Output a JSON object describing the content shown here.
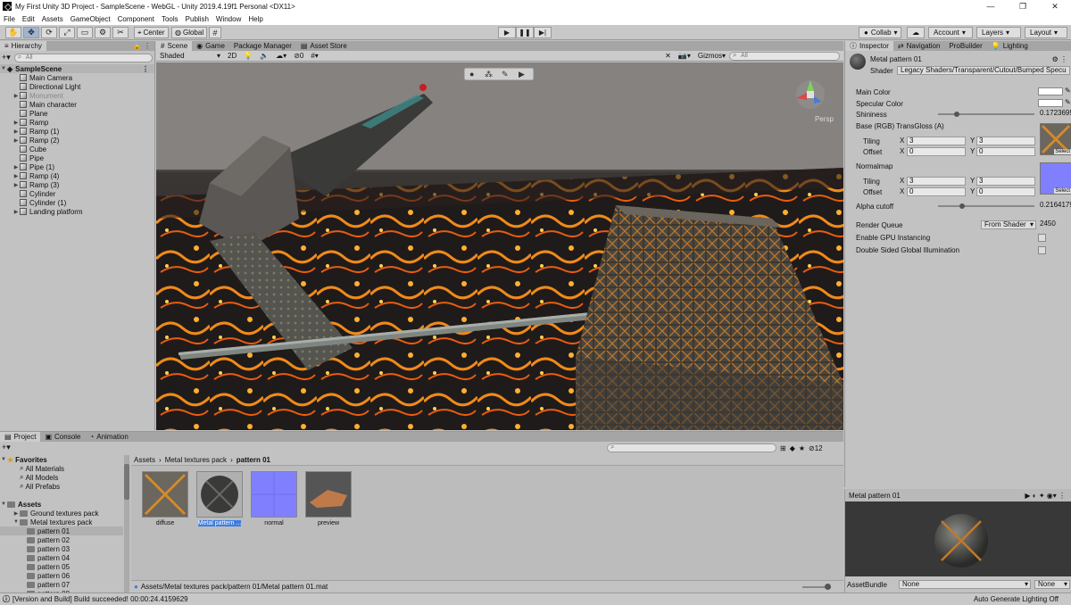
{
  "window": {
    "title": "My First Unity 3D Project - SampleScene - WebGL - Unity 2019.4.19f1 Personal <DX11>",
    "controls": [
      "—",
      "❐",
      "✕"
    ]
  },
  "menu": [
    "File",
    "Edit",
    "Assets",
    "GameObject",
    "Component",
    "Tools",
    "Publish",
    "Window",
    "Help"
  ],
  "toolbar": {
    "tools": [
      "✋",
      "✥",
      "⟳",
      "⤢",
      "▭",
      "⚙",
      "✂"
    ],
    "pivot": "Center",
    "space": "Global",
    "play": "▶",
    "pause": "❚❚",
    "step": "▶|",
    "collab": "Collab",
    "cloud": "☁",
    "account": "Account",
    "layers": "Layers",
    "layout": "Layout"
  },
  "hierarchy": {
    "tab": "Hierarchy",
    "search_placeholder": "All",
    "scene": "SampleScene",
    "items": [
      {
        "label": "Main Camera",
        "expandable": false,
        "disabled": false
      },
      {
        "label": "Directional Light",
        "expandable": false,
        "disabled": false
      },
      {
        "label": "Monument",
        "expandable": true,
        "disabled": true
      },
      {
        "label": "Main character",
        "expandable": false,
        "disabled": false
      },
      {
        "label": "Plane",
        "expandable": false,
        "disabled": false
      },
      {
        "label": "Ramp",
        "expandable": true,
        "disabled": false
      },
      {
        "label": "Ramp (1)",
        "expandable": true,
        "disabled": false
      },
      {
        "label": "Ramp (2)",
        "expandable": true,
        "disabled": false
      },
      {
        "label": "Cube",
        "expandable": false,
        "disabled": false
      },
      {
        "label": "Pipe",
        "expandable": false,
        "disabled": false
      },
      {
        "label": "Pipe (1)",
        "expandable": true,
        "disabled": false
      },
      {
        "label": "Ramp (4)",
        "expandable": true,
        "disabled": false
      },
      {
        "label": "Ramp (3)",
        "expandable": true,
        "disabled": false
      },
      {
        "label": "Cylinder",
        "expandable": false,
        "disabled": false
      },
      {
        "label": "Cylinder (1)",
        "expandable": false,
        "disabled": false
      },
      {
        "label": "Landing platform",
        "expandable": true,
        "disabled": false
      }
    ]
  },
  "scene": {
    "tabs": [
      "Scene",
      "Game",
      "Package Manager",
      "Asset Store"
    ],
    "shading": "Shaded",
    "mode2d": "2D",
    "hidden_count": "0",
    "gizmos": "Gizmos",
    "search_placeholder": "All",
    "persp": "Persp"
  },
  "inspector": {
    "tabs": [
      "Inspector",
      "Navigation",
      "ProBuilder",
      "Lighting"
    ],
    "material_name": "Metal pattern 01",
    "shader_label": "Shader",
    "shader_value": "Legacy Shaders/Transparent/Cutout/Bumped Specu",
    "main_color": "Main Color",
    "specular_color": "Specular Color",
    "shininess_label": "Shininess",
    "shininess_value": "0.1723695",
    "shininess_level": 0.17,
    "base_label": "Base (RGB) TransGloss (A)",
    "tiling": "Tiling",
    "offset": "Offset",
    "base_tiling_x": "3",
    "base_tiling_y": "3",
    "base_offset_x": "0",
    "base_offset_y": "0",
    "normalmap_label": "Normalmap",
    "normal_tiling_x": "3",
    "normal_tiling_y": "3",
    "normal_offset_x": "0",
    "normal_offset_y": "0",
    "alpha_label": "Alpha cutoff",
    "alpha_value": "0.2164179",
    "alpha_level": 0.22,
    "render_queue_label": "Render Queue",
    "render_queue_mode": "From Shader",
    "render_queue_value": "2450",
    "gpu_instancing": "Enable GPU Instancing",
    "double_sided": "Double Sided Global Illumination",
    "select": "Select",
    "x": "X",
    "y": "Y"
  },
  "preview": {
    "title": "Metal pattern 01",
    "assetbundle_label": "AssetBundle",
    "assetbundle_value": "None",
    "variant_value": "None"
  },
  "project": {
    "tabs": [
      "Project",
      "Console",
      "Animation"
    ],
    "favorites": "Favorites",
    "favorite_items": [
      "All Materials",
      "All Models",
      "All Prefabs"
    ],
    "assets": "Assets",
    "folders": [
      {
        "label": "Ground textures pack",
        "level": 1
      },
      {
        "label": "Metal textures pack",
        "level": 1
      },
      {
        "label": "pattern 01",
        "level": 2
      },
      {
        "label": "pattern 02",
        "level": 2
      },
      {
        "label": "pattern 03",
        "level": 2
      },
      {
        "label": "pattern 04",
        "level": 2
      },
      {
        "label": "pattern 05",
        "level": 2
      },
      {
        "label": "pattern 06",
        "level": 2
      },
      {
        "label": "pattern 07",
        "level": 2
      },
      {
        "label": "pattern 08",
        "level": 2
      }
    ],
    "breadcrumb": [
      "Assets",
      "Metal textures pack",
      "pattern 01"
    ],
    "assets_grid": [
      {
        "label": "diffuse",
        "kind": "diffuse"
      },
      {
        "label": "Metal pattern ...",
        "kind": "material"
      },
      {
        "label": "normal",
        "kind": "normal"
      },
      {
        "label": "preview",
        "kind": "preview"
      }
    ],
    "hidden_count": "12",
    "path": "Assets/Metal textures pack/pattern 01/Metal pattern 01.mat"
  },
  "status": {
    "message": "[Version and Build] Build succeeded! 00:00:24.4159629",
    "right": "Auto Generate Lighting Off"
  },
  "colors": {
    "accent": "#3e7de0",
    "lava": "#f0a020",
    "normal_map": "#8080ff"
  }
}
